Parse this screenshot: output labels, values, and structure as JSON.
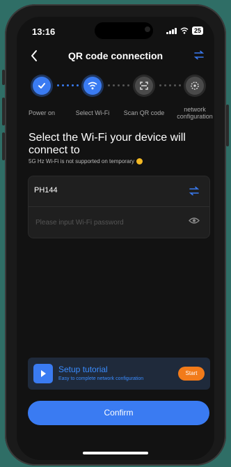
{
  "status_bar": {
    "time": "13:16",
    "battery": "25"
  },
  "nav": {
    "title": "QR code connection"
  },
  "steps": [
    {
      "label": "Power on",
      "state": "done"
    },
    {
      "label": "Select Wi-Fi",
      "state": "active"
    },
    {
      "label": "Scan QR code",
      "state": "pending"
    },
    {
      "label": "network configuration",
      "state": "pending"
    }
  ],
  "heading": "Select the Wi-Fi your device will connect to",
  "note": "5G Hz Wi-Fi is not supported on temporary",
  "wifi": {
    "ssid": "PH144",
    "password_value": "",
    "password_placeholder": "Please input Wi-Fi password"
  },
  "tutorial": {
    "title": "Setup tutorial",
    "subtitle": "Easy to complete network configuration",
    "start_label": "Start"
  },
  "confirm_label": "Confirm",
  "colors": {
    "accent": "#3a7bf2",
    "background": "#121212",
    "card": "#1f1f1f",
    "start_button": "#f27b1a",
    "warning": "#f2b824",
    "page_background": "#2f6e66"
  },
  "icons": {
    "back": "chevron-left-icon",
    "switch": "switch-arrows-icon",
    "step1": "check-icon",
    "step2": "wifi-icon",
    "step3": "scan-qr-icon",
    "step4": "network-config-icon",
    "eye": "eye-icon",
    "play": "play-icon",
    "warning": "warning-dot-icon"
  }
}
